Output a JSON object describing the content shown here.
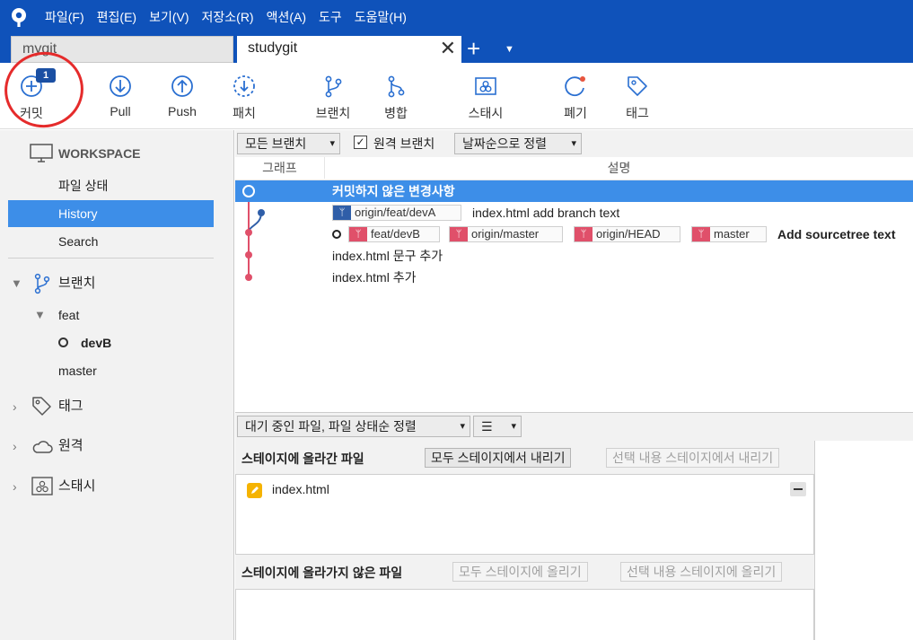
{
  "menu": {
    "items": [
      "파일(F)",
      "편집(E)",
      "보기(V)",
      "저장소(R)",
      "액션(A)",
      "도구",
      "도움말(H)"
    ]
  },
  "tabs": [
    {
      "label": "mygit",
      "active": false
    },
    {
      "label": "studygit",
      "active": true
    }
  ],
  "toolbar": {
    "commit": {
      "label": "커밋",
      "badge": "1"
    },
    "pull": "Pull",
    "push": "Push",
    "patch": "패치",
    "branch": "브랜치",
    "merge": "병합",
    "stash": "스태시",
    "discard": "폐기",
    "tag": "태그"
  },
  "sidebar": {
    "workspace": "WORKSPACE",
    "file_status": "파일 상태",
    "history": "History",
    "search": "Search",
    "branches": "브랜치",
    "feat": "feat",
    "devB": "devB",
    "master": "master",
    "tags": "태그",
    "remote": "원격",
    "stash": "스태시"
  },
  "filter": {
    "branches": "모든 브랜치",
    "remote_checkbox": "원격 브랜치",
    "remote_checked": true,
    "sort": "날짜순으로 정렬"
  },
  "graph_header": {
    "graph": "그래프",
    "description": "설명"
  },
  "commits": [
    {
      "message": "커밋하지 않은 변경사항",
      "refs": []
    },
    {
      "message": "index.html add branch text",
      "refs": [
        {
          "name": "origin/feat/devA",
          "color": "#2f5ea8"
        }
      ]
    },
    {
      "message": "Add sourcetree text",
      "refs": [
        {
          "name": "feat/devB",
          "color": "#e0506a"
        },
        {
          "name": "origin/master",
          "color": "#e0506a"
        },
        {
          "name": "origin/HEAD",
          "color": "#e0506a"
        },
        {
          "name": "master",
          "color": "#e0506a"
        }
      ]
    },
    {
      "message": "index.html 문구 추가",
      "refs": []
    },
    {
      "message": "index.html 추가",
      "refs": []
    }
  ],
  "lower": {
    "sort_dropdown": "대기 중인 파일, 파일 상태순 정렬",
    "view_dropdown": "☰",
    "staged_title": "스테이지에 올라간 파일",
    "unstage_all": "모두 스테이지에서 내리기",
    "unstage_selected": "선택 내용 스테이지에서 내리기",
    "staged_files": [
      "index.html"
    ],
    "unstaged_title": "스테이지에 올라가지 않은 파일",
    "stage_all": "모두 스테이지에 올리기",
    "stage_selected": "선택 내용 스테이지에 올리기"
  },
  "colors": {
    "brand": "#0f52ba",
    "selection": "#3d8ee8",
    "graph_red": "#e0506a",
    "graph_blue": "#2f5ea8",
    "annotation": "#e52b2b"
  }
}
